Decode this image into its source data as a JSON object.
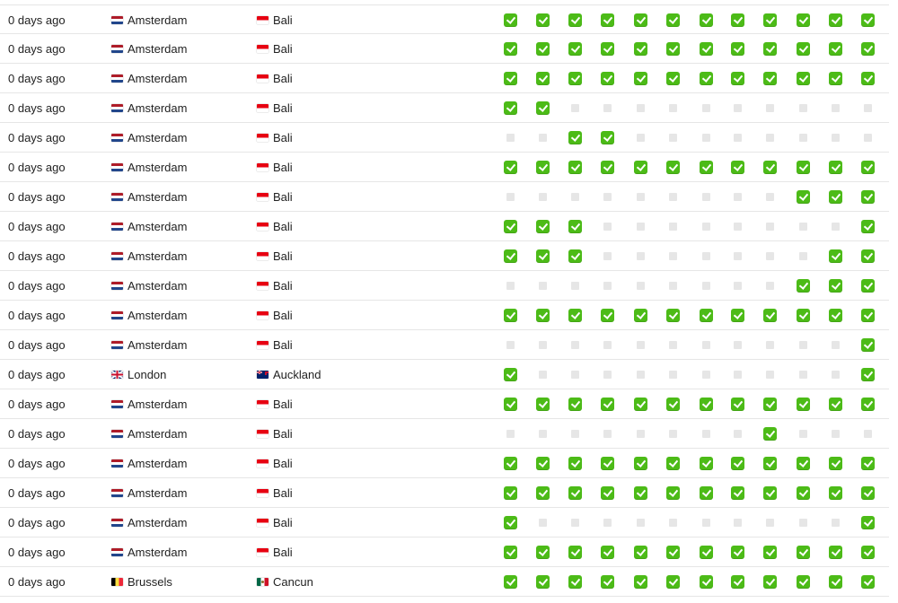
{
  "colors": {
    "check_on": "#4cbb17",
    "check_off": "#e6e6e6",
    "row_border": "#e6e6e6",
    "text": "#222222"
  },
  "icons": {
    "check_on": "check-mark-icon",
    "check_off": "empty-square-icon"
  },
  "rows": [
    {
      "time": "0 days ago",
      "from": {
        "city": "Amsterdam",
        "flag": "nl"
      },
      "to": {
        "city": "Bali",
        "flag": "id"
      },
      "checks": [
        1,
        1,
        1,
        1,
        1,
        1,
        1,
        1,
        1,
        1,
        1,
        1
      ]
    },
    {
      "time": "0 days ago",
      "from": {
        "city": "Amsterdam",
        "flag": "nl"
      },
      "to": {
        "city": "Bali",
        "flag": "id"
      },
      "checks": [
        1,
        1,
        1,
        1,
        1,
        1,
        1,
        1,
        1,
        1,
        1,
        1
      ]
    },
    {
      "time": "0 days ago",
      "from": {
        "city": "Amsterdam",
        "flag": "nl"
      },
      "to": {
        "city": "Bali",
        "flag": "id"
      },
      "checks": [
        1,
        1,
        1,
        1,
        1,
        1,
        1,
        1,
        1,
        1,
        1,
        1
      ]
    },
    {
      "time": "0 days ago",
      "from": {
        "city": "Amsterdam",
        "flag": "nl"
      },
      "to": {
        "city": "Bali",
        "flag": "id"
      },
      "checks": [
        1,
        1,
        0,
        0,
        0,
        0,
        0,
        0,
        0,
        0,
        0,
        0
      ]
    },
    {
      "time": "0 days ago",
      "from": {
        "city": "Amsterdam",
        "flag": "nl"
      },
      "to": {
        "city": "Bali",
        "flag": "id"
      },
      "checks": [
        0,
        0,
        1,
        1,
        0,
        0,
        0,
        0,
        0,
        0,
        0,
        0
      ]
    },
    {
      "time": "0 days ago",
      "from": {
        "city": "Amsterdam",
        "flag": "nl"
      },
      "to": {
        "city": "Bali",
        "flag": "id"
      },
      "checks": [
        1,
        1,
        1,
        1,
        1,
        1,
        1,
        1,
        1,
        1,
        1,
        1
      ]
    },
    {
      "time": "0 days ago",
      "from": {
        "city": "Amsterdam",
        "flag": "nl"
      },
      "to": {
        "city": "Bali",
        "flag": "id"
      },
      "checks": [
        0,
        0,
        0,
        0,
        0,
        0,
        0,
        0,
        0,
        1,
        1,
        1
      ]
    },
    {
      "time": "0 days ago",
      "from": {
        "city": "Amsterdam",
        "flag": "nl"
      },
      "to": {
        "city": "Bali",
        "flag": "id"
      },
      "checks": [
        1,
        1,
        1,
        0,
        0,
        0,
        0,
        0,
        0,
        0,
        0,
        1
      ]
    },
    {
      "time": "0 days ago",
      "from": {
        "city": "Amsterdam",
        "flag": "nl"
      },
      "to": {
        "city": "Bali",
        "flag": "id"
      },
      "checks": [
        1,
        1,
        1,
        0,
        0,
        0,
        0,
        0,
        0,
        0,
        1,
        1
      ]
    },
    {
      "time": "0 days ago",
      "from": {
        "city": "Amsterdam",
        "flag": "nl"
      },
      "to": {
        "city": "Bali",
        "flag": "id"
      },
      "checks": [
        0,
        0,
        0,
        0,
        0,
        0,
        0,
        0,
        0,
        1,
        1,
        1
      ]
    },
    {
      "time": "0 days ago",
      "from": {
        "city": "Amsterdam",
        "flag": "nl"
      },
      "to": {
        "city": "Bali",
        "flag": "id"
      },
      "checks": [
        1,
        1,
        1,
        1,
        1,
        1,
        1,
        1,
        1,
        1,
        1,
        1
      ]
    },
    {
      "time": "0 days ago",
      "from": {
        "city": "Amsterdam",
        "flag": "nl"
      },
      "to": {
        "city": "Bali",
        "flag": "id"
      },
      "checks": [
        0,
        0,
        0,
        0,
        0,
        0,
        0,
        0,
        0,
        0,
        0,
        1
      ]
    },
    {
      "time": "0 days ago",
      "from": {
        "city": "London",
        "flag": "gb"
      },
      "to": {
        "city": "Auckland",
        "flag": "nz"
      },
      "checks": [
        1,
        0,
        0,
        0,
        0,
        0,
        0,
        0,
        0,
        0,
        0,
        1
      ]
    },
    {
      "time": "0 days ago",
      "from": {
        "city": "Amsterdam",
        "flag": "nl"
      },
      "to": {
        "city": "Bali",
        "flag": "id"
      },
      "checks": [
        1,
        1,
        1,
        1,
        1,
        1,
        1,
        1,
        1,
        1,
        1,
        1
      ]
    },
    {
      "time": "0 days ago",
      "from": {
        "city": "Amsterdam",
        "flag": "nl"
      },
      "to": {
        "city": "Bali",
        "flag": "id"
      },
      "checks": [
        0,
        0,
        0,
        0,
        0,
        0,
        0,
        0,
        1,
        0,
        0,
        0
      ]
    },
    {
      "time": "0 days ago",
      "from": {
        "city": "Amsterdam",
        "flag": "nl"
      },
      "to": {
        "city": "Bali",
        "flag": "id"
      },
      "checks": [
        1,
        1,
        1,
        1,
        1,
        1,
        1,
        1,
        1,
        1,
        1,
        1
      ]
    },
    {
      "time": "0 days ago",
      "from": {
        "city": "Amsterdam",
        "flag": "nl"
      },
      "to": {
        "city": "Bali",
        "flag": "id"
      },
      "checks": [
        1,
        1,
        1,
        1,
        1,
        1,
        1,
        1,
        1,
        1,
        1,
        1
      ]
    },
    {
      "time": "0 days ago",
      "from": {
        "city": "Amsterdam",
        "flag": "nl"
      },
      "to": {
        "city": "Bali",
        "flag": "id"
      },
      "checks": [
        1,
        0,
        0,
        0,
        0,
        0,
        0,
        0,
        0,
        0,
        0,
        1
      ]
    },
    {
      "time": "0 days ago",
      "from": {
        "city": "Amsterdam",
        "flag": "nl"
      },
      "to": {
        "city": "Bali",
        "flag": "id"
      },
      "checks": [
        1,
        1,
        1,
        1,
        1,
        1,
        1,
        1,
        1,
        1,
        1,
        1
      ]
    },
    {
      "time": "0 days ago",
      "from": {
        "city": "Brussels",
        "flag": "be"
      },
      "to": {
        "city": "Cancun",
        "flag": "mx"
      },
      "checks": [
        1,
        1,
        1,
        1,
        1,
        1,
        1,
        1,
        1,
        1,
        1,
        1
      ]
    }
  ]
}
